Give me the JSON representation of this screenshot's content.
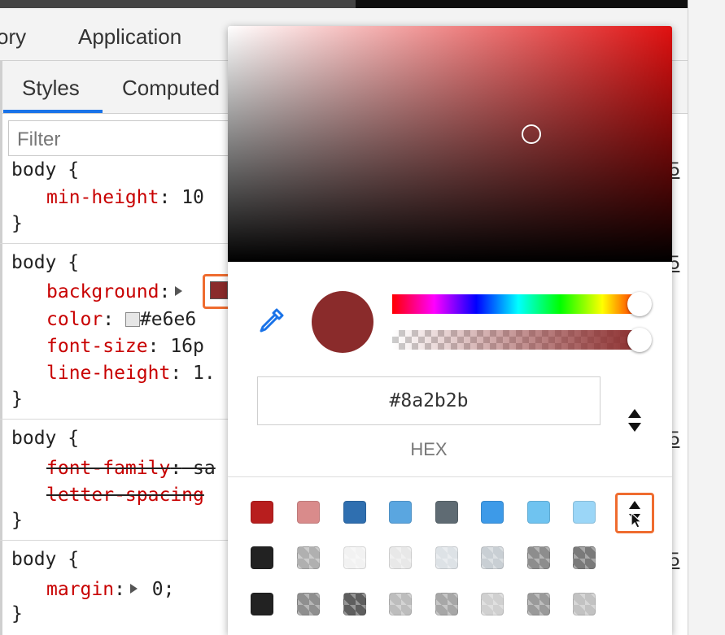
{
  "main_tabs": [
    {
      "label": "ory"
    },
    {
      "label": "Application"
    }
  ],
  "styles_tabs": [
    {
      "label": "Styles",
      "active": true
    },
    {
      "label": "Computed"
    }
  ],
  "filter": {
    "placeholder": "Filter"
  },
  "rules": [
    {
      "line1": "body {",
      "line2_prop": "min-height",
      "line2_val": " 10",
      "close": "}"
    },
    {
      "selector": "body {",
      "background_prop": "background",
      "color_prop": "color",
      "color_val": "#e6e6",
      "fontsize_prop": "font-size",
      "fontsize_val": " 16p",
      "lineheight_prop": "line-height",
      "lineheight_val": " 1.",
      "close": "}"
    },
    {
      "selector": "body {",
      "fontfamily_prop": "font-family",
      "fontfamily_val": " sa",
      "letterspacing_prop": "letter-spacing",
      "close": "}"
    },
    {
      "selector": "body {",
      "margin_prop": "margin",
      "margin_val": " 0;",
      "close": "}"
    }
  ],
  "source_links": [
    "5",
    "5",
    "5",
    "5",
    "5"
  ],
  "picker": {
    "hex_value": "#8a2b2b",
    "format_label": "HEX",
    "current_color": "#8a2b2b",
    "hue_fraction": 1.0,
    "alpha_fraction": 1.0
  },
  "palette": [
    [
      "#b81e1e",
      "#d98b8b",
      "#2f6fb0",
      "#5aa6e0",
      "#5f6b73",
      "#3d9ae8",
      "#6fc3f0",
      "#9bd6f7"
    ],
    [
      "#222222",
      "#b0b0b0",
      "#f2f2f2",
      "#e8e8e8",
      "#dde2e6",
      "#c9cfd4",
      "#8d8d8d",
      "#7a7a7a"
    ],
    [
      "#222222",
      "#8f8f8f",
      "#5e5e5e",
      "#bdbdbd",
      "#a7a7a7",
      "#d0d0d0",
      "#9a9a9a",
      "#c2c2c2"
    ]
  ],
  "icons": {
    "eyedropper": "eyedropper-icon",
    "format_toggle": "up-down-arrows-icon",
    "palette_toggle": "up-down-arrows-icon",
    "expand": "triangle-right-icon",
    "cursor": "mouse-pointer-icon"
  },
  "colors": {
    "accent": "#1a73e8",
    "highlight": "#ef6c2f",
    "property": "#c80000"
  }
}
